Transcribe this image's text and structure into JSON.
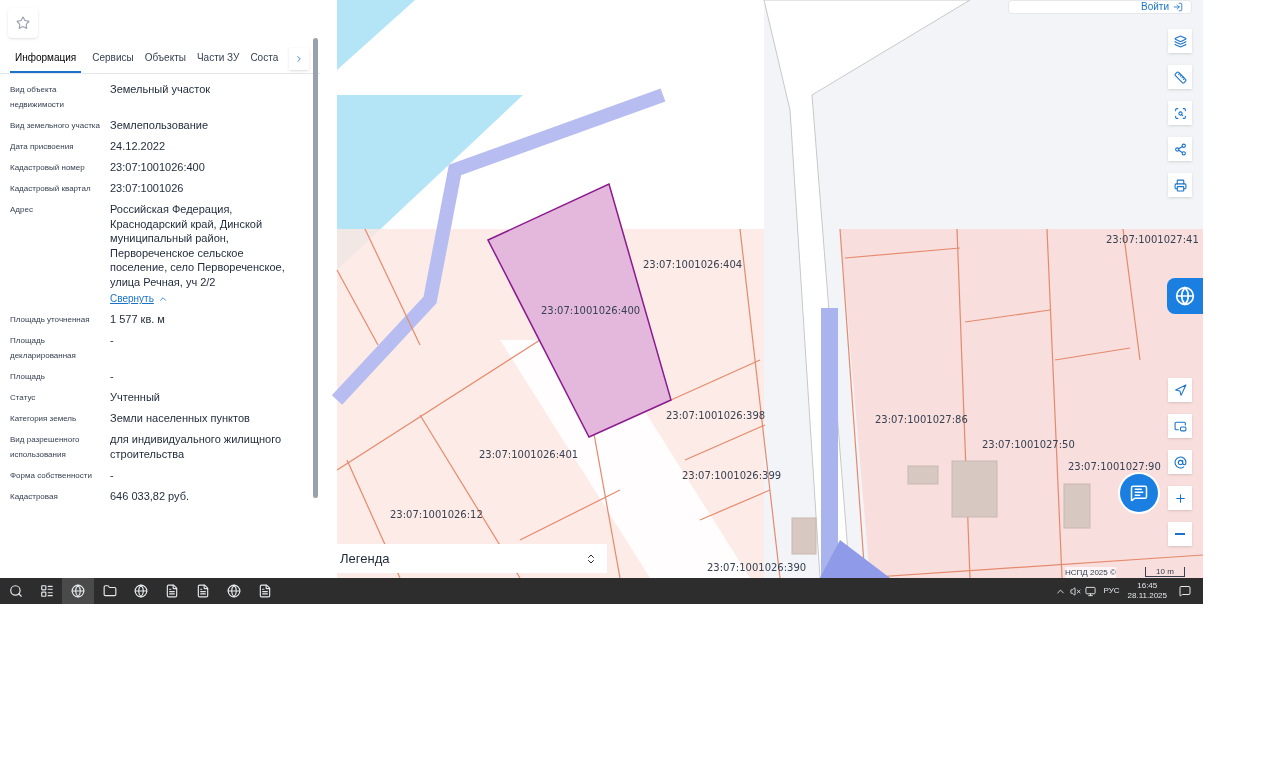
{
  "panel": {
    "tabs": [
      {
        "label": "Информация",
        "selected": true
      },
      {
        "label": "Сервисы",
        "selected": false
      },
      {
        "label": "Объекты",
        "selected": false
      },
      {
        "label": "Части ЗУ",
        "selected": false
      },
      {
        "label": "Соста",
        "selected": false
      }
    ],
    "fields": [
      {
        "label": "Вид объекта недвижимости",
        "value": "Земельный участок"
      },
      {
        "label": "Вид земельного участка",
        "value": "Землепользование"
      },
      {
        "label": "Дата присвоения",
        "value": "24.12.2022"
      },
      {
        "label": "Кадастровый номер",
        "value": "23:07:1001026:400"
      },
      {
        "label": "Кадастровый квартал",
        "value": "23:07:1001026"
      },
      {
        "label": "Адрес",
        "value": "Российская Федерация, Краснодарский край, Динской муниципальный район, Первореченское сельское поселение, село Первореченское, улица Речная, уч 2/2",
        "link": "Свернуть"
      },
      {
        "label": "Площадь уточненная",
        "value": "1 577 кв. м"
      },
      {
        "label": "Площадь декларированная",
        "value": "-"
      },
      {
        "label": "Площадь",
        "value": "-"
      },
      {
        "label": "Статус",
        "value": "Учтенный"
      },
      {
        "label": "Категория земель",
        "value": "Земли населенных пунктов"
      },
      {
        "label": "Вид разрешенного использования",
        "value": "для индивидуального жилищного строительства"
      },
      {
        "label": "Форма собственности",
        "value": "-"
      },
      {
        "label": "Кадастровая",
        "value": "646 033,82 руб."
      }
    ]
  },
  "map": {
    "login_button": "Войти",
    "parcel_labels": [
      "23:07:1001026:404",
      "23:07:1001026:400",
      "23:07:1001026:398",
      "23:07:1001026:401",
      "23:07:1001026:399",
      "23:07:1001026:12",
      "23:07:1001026:390",
      "23:07:1001027:41",
      "23:07:1001027:86",
      "23:07:1001027:50",
      "23:07:1001027:90"
    ],
    "legend": "Легенда",
    "attribution": "НСПД 2025 ©",
    "scale": "10 m"
  },
  "taskbar": {
    "language": "РУС",
    "time": "16:45",
    "date": "28.11.2025"
  }
}
